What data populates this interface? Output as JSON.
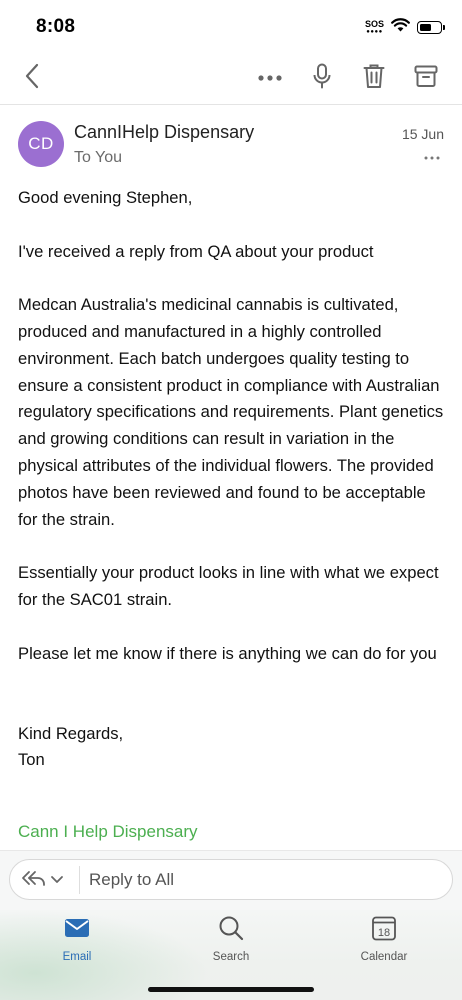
{
  "status_bar": {
    "time": "8:08",
    "sos": "SOS",
    "battery_level": 0.6
  },
  "toolbar": {
    "back": "back",
    "more": "more-options",
    "dictate": "microphone",
    "delete": "trash",
    "archive": "archive"
  },
  "message": {
    "avatar_initials": "CD",
    "avatar_color": "#9b6fd1",
    "sender": "CannIHelp Dispensary",
    "recipient": "To You",
    "date": "15 Jun",
    "greeting": "Good evening Stephen,",
    "paragraphs": [
      "I've received a reply from QA about your product",
      "Medcan Australia's medicinal cannabis is cultivated, produced and manufactured in a highly controlled environment. Each batch undergoes quality testing to ensure a consistent product in compliance with Australian regulatory specifications and requirements. Plant genetics and growing conditions can result in variation in the physical attributes of the individual flowers.  The provided photos have been reviewed and found to be acceptable for the strain.",
      "Essentially your product looks in line with what we expect for the SAC01 strain.",
      "Please let me know if there is anything we can do for you"
    ],
    "signoff": "Kind Regards,",
    "signature_name": "Ton",
    "company_link": "Cann I Help Dispensary",
    "link_color": "#4caf50"
  },
  "reply": {
    "placeholder": "Reply to All"
  },
  "tabs": {
    "email": "Email",
    "search": "Search",
    "calendar": "Calendar",
    "calendar_day": "18",
    "active_color": "#2a6db5"
  }
}
